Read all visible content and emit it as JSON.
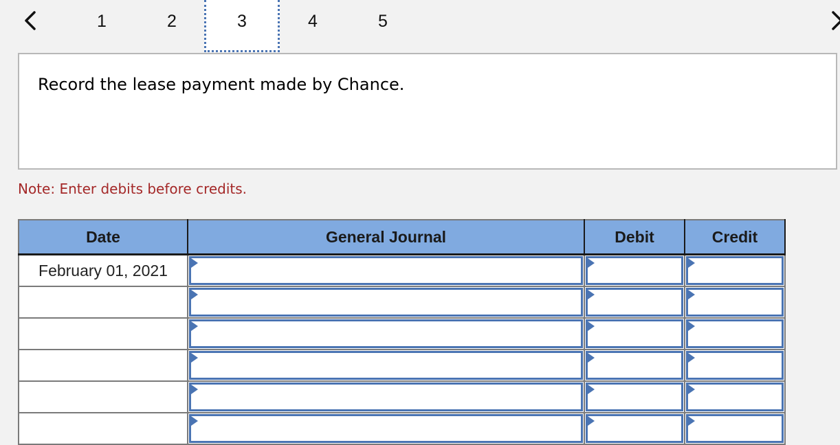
{
  "navigation": {
    "prev_icon": "chevron-left-icon",
    "next_icon": "chevron-right-icon",
    "tabs": [
      {
        "label": "1",
        "active": false
      },
      {
        "label": "2",
        "active": false
      },
      {
        "label": "3",
        "active": true
      },
      {
        "label": "4",
        "active": false
      },
      {
        "label": "5",
        "active": false
      }
    ]
  },
  "question": {
    "text": "Record the lease payment made by Chance."
  },
  "note": "Note: Enter debits before credits.",
  "journal": {
    "headers": {
      "date": "Date",
      "general_journal": "General Journal",
      "debit": "Debit",
      "credit": "Credit"
    },
    "rows": [
      {
        "date": "February 01, 2021",
        "account": "",
        "debit": "",
        "credit": ""
      },
      {
        "date": "",
        "account": "",
        "debit": "",
        "credit": ""
      },
      {
        "date": "",
        "account": "",
        "debit": "",
        "credit": ""
      },
      {
        "date": "",
        "account": "",
        "debit": "",
        "credit": ""
      },
      {
        "date": "",
        "account": "",
        "debit": "",
        "credit": ""
      },
      {
        "date": "",
        "account": "",
        "debit": "",
        "credit": ""
      }
    ],
    "colors": {
      "header_bg": "#80aae0",
      "input_border": "#4a74b3",
      "note_color": "#a42828"
    }
  }
}
